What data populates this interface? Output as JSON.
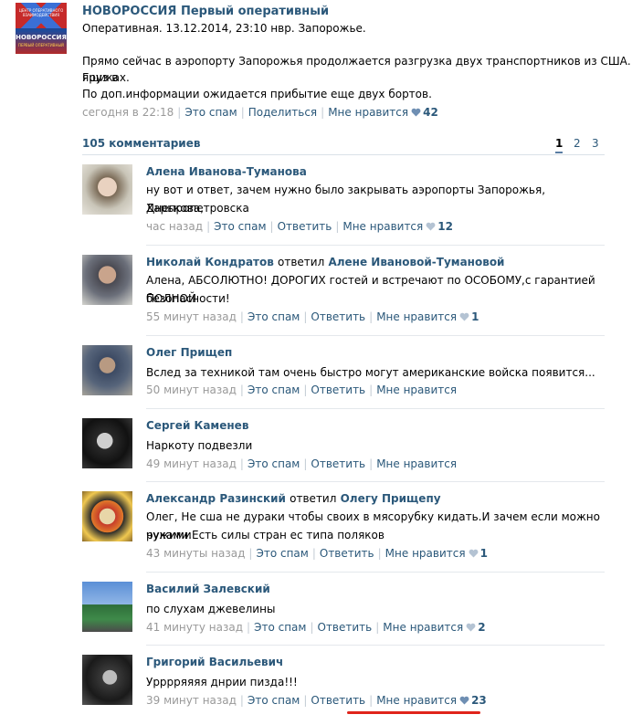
{
  "post": {
    "avatar_text_small": "ЦЕНТР ОПЕРАТИВНОГО ВЗАИМОДЕЙСТВИЯ",
    "avatar_text_big": "НОВОРОССИЯ",
    "avatar_text_sub": "ПЕРВЫЙ ОПЕРАТИВНЫЙ",
    "author": "НОВОРОССИЯ Первый оперативный",
    "line1": "Оперативная. 13.12.2014, 23:10 нвр. Запорожье.",
    "line2": "Прямо сейчас в аэропорту Запорожья продолжается разгрузка двух транспортников из США. Груз в",
    "line3": "ящиках.",
    "line4": "По доп.информации ожидается прибытие еще двух бортов.",
    "time": "сегодня в 22:18",
    "spam": "Это спам",
    "share": "Поделиться",
    "like": "Мне нравится",
    "like_count": "42"
  },
  "comments_header": {
    "count_label": "105 комментариев",
    "pages": [
      "1",
      "2",
      "3"
    ],
    "active_page": "1"
  },
  "comments": [
    {
      "author": "Алена Иванова-Туманова",
      "reply_word": "",
      "reply_to": "",
      "text1": "ну вот и ответ, зачем нужно было закрывать аэропорты Запорожья, Харькова,",
      "text2": "Днепропетровска",
      "time": "час назад",
      "spam": "Это спам",
      "reply": "Ответить",
      "like": "Мне нравится",
      "likes": "12"
    },
    {
      "author": "Николай Кондратов",
      "reply_word": "ответил",
      "reply_to": "Алене Ивановой-Тумановой",
      "text1": "Алена, АБСОЛЮТНО! ДОРОГИХ гостей и встречают по ОСОБОМУ,с гарантией ПОЛНОЙ",
      "text2": "безопасности!",
      "time": "55 минут назад",
      "spam": "Это спам",
      "reply": "Ответить",
      "like": "Мне нравится",
      "likes": "1"
    },
    {
      "author": "Олег Прищеп",
      "reply_word": "",
      "reply_to": "",
      "text1": "Вслед за техникой там очень быстро могут американские войска появится...",
      "text2": "",
      "time": "50 минут назад",
      "spam": "Это спам",
      "reply": "Ответить",
      "like": "Мне нравится",
      "likes": ""
    },
    {
      "author": "Сергей Каменев",
      "reply_word": "",
      "reply_to": "",
      "text1": "Наркоту подвезли",
      "text2": "",
      "time": "49 минут назад",
      "spam": "Это спам",
      "reply": "Ответить",
      "like": "Мне нравится",
      "likes": ""
    },
    {
      "author": "Александр Разинский",
      "reply_word": "ответил",
      "reply_to": "Олегу Прищепу",
      "text1": "Олег, Не сша не дураки чтобы своих в мясорубку кидать.И зачем если можно чужими",
      "text2": "руками.Есть силы стран ес типа поляков",
      "time": "43 минуты назад",
      "spam": "Это спам",
      "reply": "Ответить",
      "like": "Мне нравится",
      "likes": "1"
    },
    {
      "author": "Василий Залевский",
      "reply_word": "",
      "reply_to": "",
      "text1": "по слухам джевелины",
      "text2": "",
      "time": "41 минуту назад",
      "spam": "Это спам",
      "reply": "Ответить",
      "like": "Мне нравится",
      "likes": "2"
    },
    {
      "author": "Григорий Васильевич",
      "reply_word": "",
      "reply_to": "",
      "text1": "Урррряяяя днрии пизда!!!",
      "text2": "",
      "time": "39 минут назад",
      "spam": "Это спам",
      "reply": "Ответить",
      "like": "Мне нравится",
      "likes": "23"
    }
  ],
  "colors": {
    "link": "#2b587a",
    "meta": "#999999",
    "highlight": "#e0241b"
  },
  "icons": {
    "like": "heart-icon"
  }
}
